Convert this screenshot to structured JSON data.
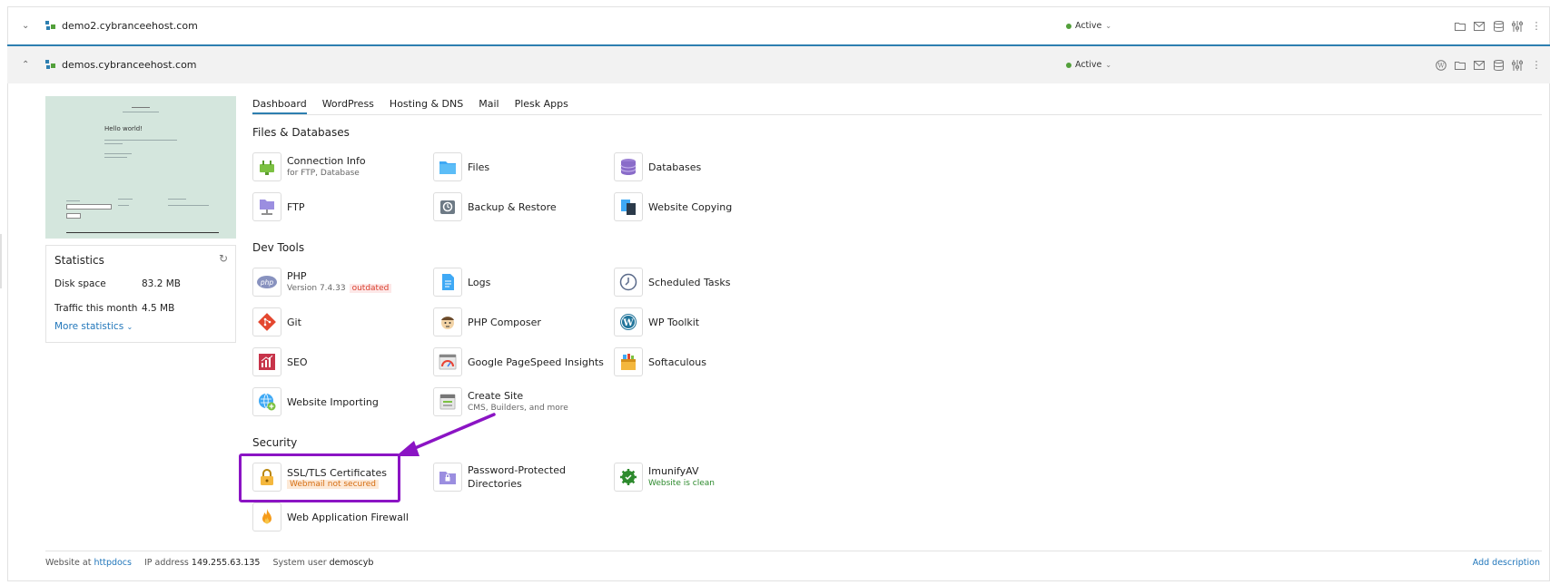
{
  "domains": [
    {
      "name": "demo2.cybranceehost.com",
      "status": "Active",
      "expanded": false
    },
    {
      "name": "demos.cybranceehost.com",
      "status": "Active",
      "expanded": true
    }
  ],
  "row_icons_1": [
    "folder-icon",
    "mail-icon",
    "database-icon",
    "sliders-icon",
    "more-icon"
  ],
  "row_icons_2": [
    "wordpress-icon",
    "folder-icon",
    "mail-icon",
    "database-icon",
    "sliders-icon",
    "more-icon"
  ],
  "preview": {
    "heading": "Hello world!"
  },
  "statistics": {
    "title": "Statistics",
    "disk_label": "Disk space",
    "disk_value": "83.2 MB",
    "traffic_label": "Traffic this month",
    "traffic_value": "4.5 MB",
    "more_label": "More statistics"
  },
  "tabs": [
    {
      "label": "Dashboard",
      "active": true
    },
    {
      "label": "WordPress"
    },
    {
      "label": "Hosting & DNS"
    },
    {
      "label": "Mail"
    },
    {
      "label": "Plesk Apps"
    }
  ],
  "sections": {
    "files": "Files & Databases",
    "dev": "Dev Tools",
    "security": "Security"
  },
  "tools": {
    "connection_info": {
      "label": "Connection Info",
      "sub": "for FTP, Database"
    },
    "files": {
      "label": "Files"
    },
    "databases": {
      "label": "Databases"
    },
    "ftp": {
      "label": "FTP"
    },
    "backup": {
      "label": "Backup & Restore"
    },
    "website_copying": {
      "label": "Website Copying"
    },
    "php": {
      "label": "PHP",
      "sub": "Version 7.4.33",
      "badge": "outdated"
    },
    "logs": {
      "label": "Logs"
    },
    "scheduled_tasks": {
      "label": "Scheduled Tasks"
    },
    "git": {
      "label": "Git"
    },
    "php_composer": {
      "label": "PHP Composer"
    },
    "wp_toolkit": {
      "label": "WP Toolkit"
    },
    "seo": {
      "label": "SEO"
    },
    "pagespeed": {
      "label": "Google PageSpeed Insights"
    },
    "softaculous": {
      "label": "Softaculous"
    },
    "website_importing": {
      "label": "Website Importing"
    },
    "create_site": {
      "label": "Create Site",
      "sub": "CMS, Builders, and more"
    },
    "ssl": {
      "label": "SSL/TLS Certificates",
      "badge": "Webmail not secured"
    },
    "password_dirs": {
      "label": "Password-Protected",
      "label2": "Directories"
    },
    "imunify": {
      "label": "ImunifyAV",
      "sub": "Website is clean"
    },
    "waf": {
      "label": "Web Application Firewall"
    }
  },
  "footer": {
    "website_at": "Website at",
    "docroot": "httpdocs",
    "ip_label": "IP address",
    "ip_value": "149.255.63.135",
    "user_label": "System user",
    "user_value": "demoscyb",
    "add_description": "Add description"
  },
  "colors": {
    "accent": "#2d7fb0",
    "highlight": "#8b14c4",
    "active_dot": "#53a03b"
  }
}
